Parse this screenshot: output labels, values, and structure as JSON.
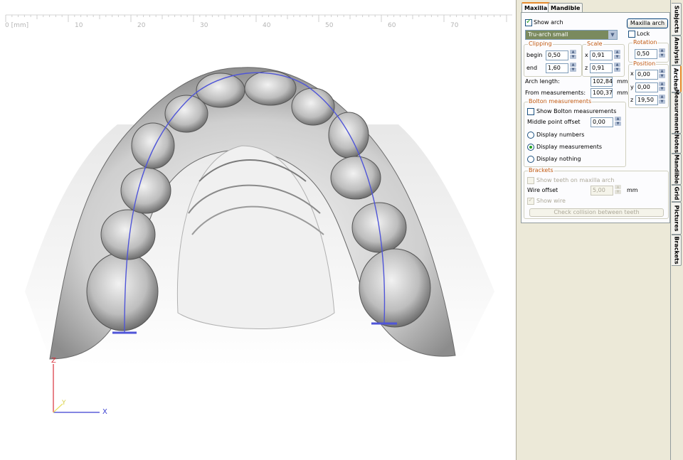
{
  "viewport": {
    "ruler_labels": [
      "0 [mm]",
      "10",
      "20",
      "30",
      "40",
      "50",
      "60",
      "70"
    ],
    "axes": {
      "z": "Z",
      "y": "Y",
      "x": "X"
    },
    "colors": {
      "arch_curve": "#4f55d8",
      "axis_x": "#3a3fd0",
      "axis_z": "#d8303a",
      "axis_y": "#e8e060"
    }
  },
  "panel": {
    "tabs": [
      {
        "label": "Maxilla",
        "active": true
      },
      {
        "label": "Mandible",
        "active": false
      }
    ],
    "show_arch": {
      "label": "Show arch",
      "checked": true
    },
    "maxilla_arch_button": "Maxilla arch",
    "arch_type": "Tru-arch small",
    "lock": {
      "label": "Lock",
      "checked": false
    },
    "clipping": {
      "title": "Clipping",
      "begin_label": "begin",
      "begin": "0,50",
      "end_label": "end",
      "end": "1,60"
    },
    "scale": {
      "title": "Scale",
      "x_label": "x",
      "x": "0,91",
      "z_label": "z",
      "z": "0,91"
    },
    "rotation": {
      "title": "Rotation",
      "value": "0,50"
    },
    "position": {
      "title": "Position",
      "x_label": "x",
      "x": "0,00",
      "y_label": "y",
      "y": "0,00",
      "z_label": "z",
      "z": "19,50"
    },
    "arch_length": {
      "label": "Arch length:",
      "value": "102,84",
      "unit": "mm"
    },
    "from_measurements": {
      "label": "From measurements:",
      "value": "100,37",
      "unit": "mm"
    },
    "bolton": {
      "title": "Bolton measurements",
      "show": {
        "label": "Show Bolton measurements",
        "checked": false
      },
      "middle_label": "Middle point offset",
      "middle_value": "0,00",
      "options": [
        {
          "label": "Display numbers",
          "selected": false
        },
        {
          "label": "Display measurements",
          "selected": true
        },
        {
          "label": "Display nothing",
          "selected": false
        }
      ]
    },
    "brackets": {
      "title": "Brackets",
      "show_teeth": {
        "label": "Show teeth on maxilla arch",
        "checked": false
      },
      "wire_offset_label": "Wire offset",
      "wire_offset_value": "5,00",
      "wire_offset_unit": "mm",
      "show_wire": {
        "label": "Show wire",
        "checked": true
      },
      "check_button": "Check collision between teeth"
    }
  },
  "side_tabs": [
    {
      "label": "Subjects",
      "active": false
    },
    {
      "label": "Analysis",
      "active": false
    },
    {
      "label": "Arches",
      "active": true
    },
    {
      "label": "Measurements",
      "active": false
    },
    {
      "label": "Notes",
      "active": false
    },
    {
      "label": "Mandible",
      "active": false
    },
    {
      "label": "Grid",
      "active": false
    },
    {
      "label": "Pictures",
      "active": false
    },
    {
      "label": "Brackets",
      "active": false
    }
  ]
}
